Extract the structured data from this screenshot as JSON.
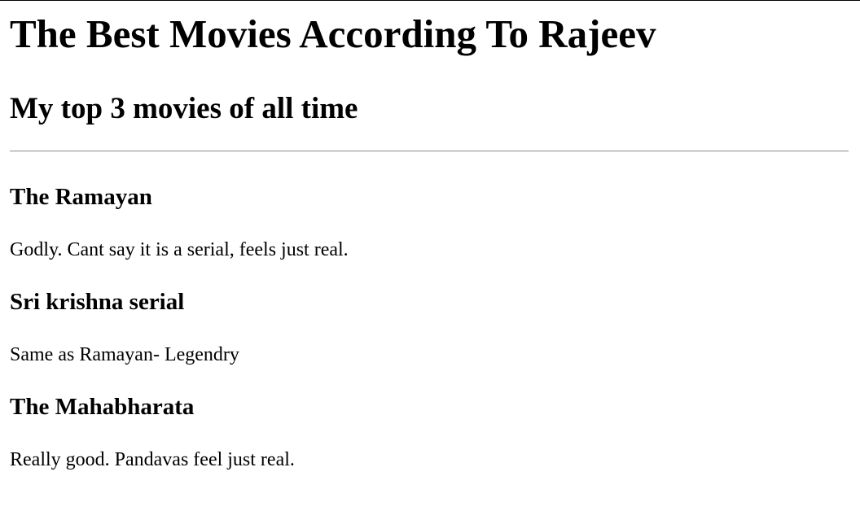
{
  "header": {
    "title": "The Best Movies According To Rajeev",
    "subtitle": "My top 3 movies of all time"
  },
  "movies": [
    {
      "title": "The Ramayan",
      "description": "Godly. Cant say it is a serial, feels just real."
    },
    {
      "title": "Sri krishna serial",
      "description": "Same as Ramayan- Legendry"
    },
    {
      "title": "The Mahabharata",
      "description": "Really good. Pandavas feel just real."
    }
  ]
}
